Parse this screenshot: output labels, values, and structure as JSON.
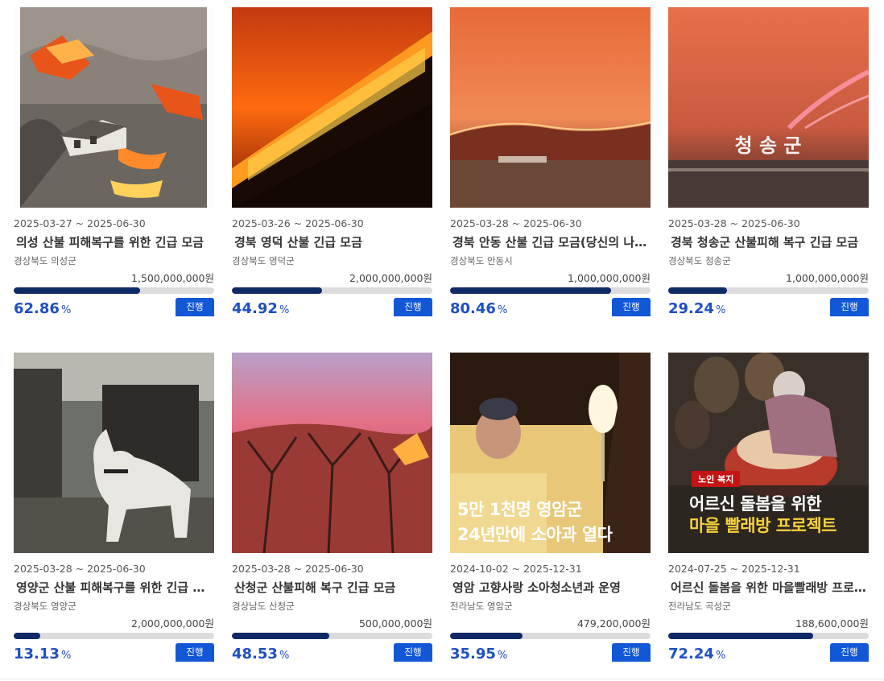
{
  "cards": [
    {
      "date": "2025-03-27 ~ 2025-06-30",
      "title": "의성 산불 피해복구를 위한 긴급 모금",
      "region": "경상북도 의성군",
      "goal": "1,500,000,000원",
      "percent": "62.86",
      "fill": 0.6286,
      "status": "진행"
    },
    {
      "date": "2025-03-26 ~ 2025-06-30",
      "title": "경북 영덕 산불 긴급 모금",
      "region": "경상북도 영덕군",
      "goal": "2,000,000,000원",
      "percent": "44.92",
      "fill": 0.4492,
      "status": "진행"
    },
    {
      "date": "2025-03-28 ~ 2025-06-30",
      "title": "경북 안동 산불 긴급 모금(당신의 나눔이",
      "region": "경상북도 안동시",
      "goal": "1,000,000,000원",
      "percent": "80.46",
      "fill": 0.8046,
      "status": "진행"
    },
    {
      "date": "2025-03-28 ~ 2025-06-30",
      "title": "경북 청송군 산불피해 복구 긴급 모금",
      "region": "경상북도 청송군",
      "goal": "1,000,000,000원",
      "percent": "29.24",
      "fill": 0.2924,
      "status": "진행"
    },
    {
      "date": "2025-03-28 ~ 2025-06-30",
      "title": "영양군 산불 피해복구를 위한 긴급 모금",
      "region": "경상북도 영양군",
      "goal": "2,000,000,000원",
      "percent": "13.13",
      "fill": 0.1313,
      "status": "진행"
    },
    {
      "date": "2025-03-28 ~ 2025-06-30",
      "title": "산청군 산불피해 복구 긴급 모금",
      "region": "경상남도 산청군",
      "goal": "500,000,000원",
      "percent": "48.53",
      "fill": 0.4853,
      "status": "진행"
    },
    {
      "date": "2024-10-02 ~ 2025-12-31",
      "title": "영암 고향사랑 소아청소년과 운영",
      "region": "전라남도 영암군",
      "goal": "479,200,000원",
      "percent": "35.95",
      "fill": 0.3595,
      "status": "진행"
    },
    {
      "date": "2024-07-25 ~ 2025-12-31",
      "title": "어르신 돌봄을 위한 마을빨래방 프로젝트",
      "region": "전라남도 곡성군",
      "goal": "188,600,000원",
      "percent": "72.24",
      "fill": 0.7224,
      "status": "진행"
    }
  ],
  "percent_unit": "%",
  "images": {
    "img4_sign": "청 송 군",
    "img7_line1": "5만 1천명 영암군",
    "img7_line2": "24년만에 소아과 열다",
    "img8_tag": "노인 복지",
    "img8_line1": "어르신 돌봄을 위한",
    "img8_line2": "마을 빨래방 프로젝트"
  },
  "colors": {
    "accent": "#1258d6",
    "percent": "#1e4fc4",
    "bar_fill": "#102a66",
    "bar_track": "#dcdcdc"
  }
}
